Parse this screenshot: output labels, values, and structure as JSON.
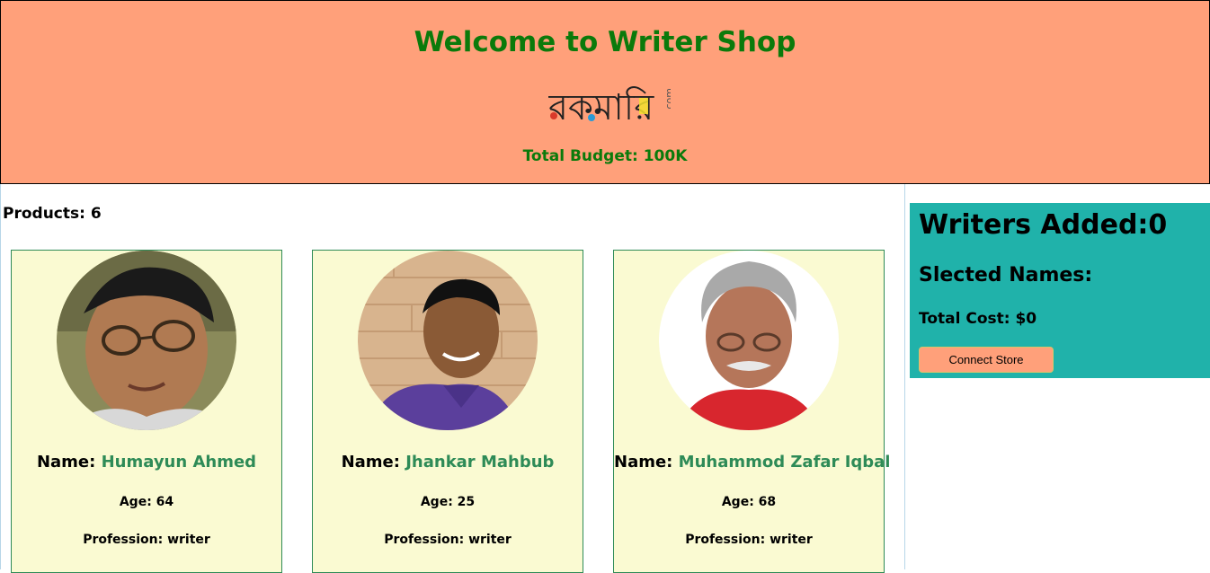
{
  "header": {
    "title": "Welcome to Writer Shop",
    "logo_text": "রকমারি",
    "logo_suffix": ".com",
    "budget": "Total Budget: 100K"
  },
  "products": {
    "count_label": "Products: 6",
    "cards": [
      {
        "name_label": "Name:",
        "name": "Humayun Ahmed",
        "age": "Age: 64",
        "profession": "Profession: writer"
      },
      {
        "name_label": "Name:",
        "name": "Jhankar Mahbub",
        "age": "Age: 25",
        "profession": "Profession: writer"
      },
      {
        "name_label": "Name:",
        "name": "Muhammod Zafar Iqbal",
        "age": "Age: 68",
        "profession": "Profession: writer"
      }
    ]
  },
  "summary": {
    "writers_added": "Writers Added:0",
    "selected_names": "Slected Names:",
    "total_cost": "Total Cost: $0",
    "connect_button": "Connect Store"
  },
  "colors": {
    "header_bg": "#ffa07a",
    "title_green": "#0b7a0b",
    "card_bg": "#fafad2",
    "name_green": "#2e8b57",
    "summary_bg": "#20b2aa"
  }
}
